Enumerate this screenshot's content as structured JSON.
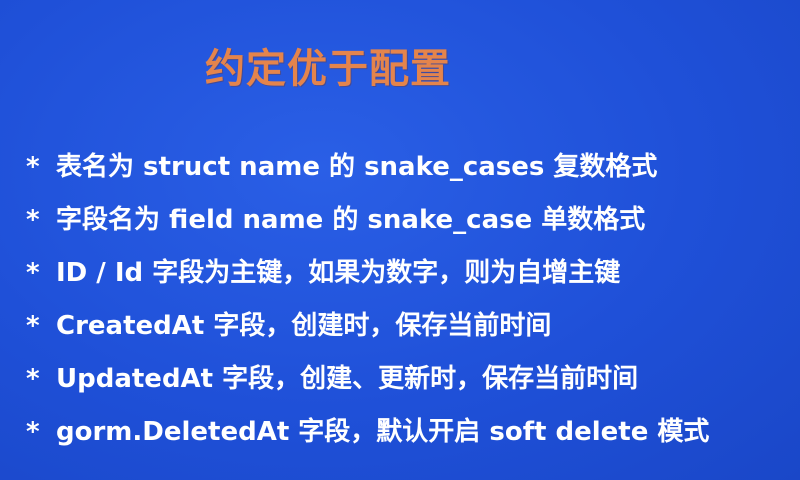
{
  "slide": {
    "title": "约定优于配置",
    "bullet_marker": "*",
    "bullets": [
      "表名为 struct name 的 snake_cases 复数格式",
      "字段名为 field name 的 snake_case 单数格式",
      "ID / Id 字段为主键，如果为数字，则为自增主键",
      "CreatedAt 字段，创建时，保存当前时间",
      "UpdatedAt 字段，创建、更新时，保存当前时间",
      "gorm.DeletedAt 字段，默认开启 soft delete 模式"
    ]
  },
  "colors": {
    "background": "#1f50d8",
    "title": "#e4844c",
    "text": "#ffffff"
  }
}
